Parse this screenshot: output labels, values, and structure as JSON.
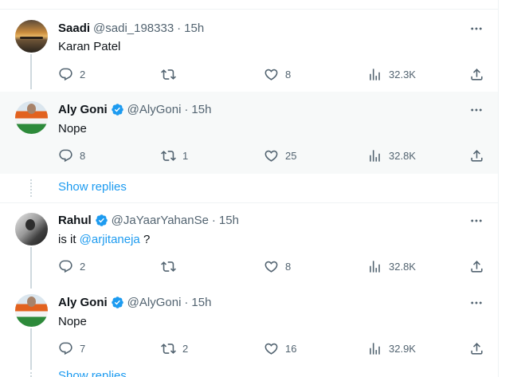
{
  "colors": {
    "accent": "#1d9bf0",
    "text": "#0f1419",
    "muted": "#536471",
    "highlight_bg": "#f7f9f9",
    "thread_line": "#cfd9de"
  },
  "replies": [
    {
      "name": "Saadi",
      "handle": "@sadi_198333",
      "dot": "·",
      "time": "15h",
      "verified": false,
      "text": "Karan Patel",
      "replies": "2",
      "retweets": "",
      "likes": "8",
      "views": "32.3K",
      "avatar_icon": "sunset-photo-avatar"
    },
    {
      "name": "Aly Goni",
      "handle": "@AlyGoni",
      "dot": "·",
      "time": "15h",
      "verified": true,
      "text": "Nope",
      "replies": "8",
      "retweets": "1",
      "likes": "25",
      "views": "32.8K",
      "avatar_icon": "flag-photo-avatar"
    },
    {
      "name": "Rahul",
      "handle": "@JaYaarYahanSe",
      "dot": "·",
      "time": "15h",
      "verified": true,
      "text_prefix": "is it ",
      "mention": "@arjitaneja",
      "text_suffix": " ?",
      "replies": "2",
      "retweets": "",
      "likes": "8",
      "views": "32.8K",
      "avatar_icon": "bw-photo-avatar"
    },
    {
      "name": "Aly Goni",
      "handle": "@AlyGoni",
      "dot": "·",
      "time": "15h",
      "verified": true,
      "text": "Nope",
      "replies": "7",
      "retweets": "2",
      "likes": "16",
      "views": "32.9K",
      "avatar_icon": "flag-photo-avatar"
    }
  ],
  "show_replies_label": "Show replies"
}
